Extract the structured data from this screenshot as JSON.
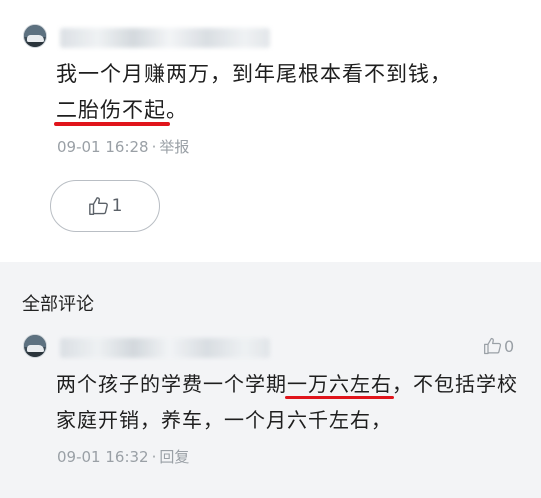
{
  "post": {
    "text_before": "我一个月赚两万，到年尾根本看不到钱，",
    "text_highlight": "二胎伤不起",
    "text_after": "。",
    "timestamp": "09-01 16:28",
    "separator": "·",
    "report_label": "举报",
    "like_count": "1"
  },
  "comments_section": {
    "title": "全部评论",
    "comments": [
      {
        "text_before": "两个孩子的学费一个学期",
        "text_highlight": "一万六左右",
        "text_after": "，不包括学校家庭开销，养车，一个月六千左右，",
        "timestamp": "09-01 16:32",
        "separator": "·",
        "reply_label": "回复",
        "like_count": "0"
      }
    ]
  },
  "colors": {
    "highlight_underline": "#e0141b",
    "meta_text": "#9aa0a6",
    "comments_background": "#f3f4f6"
  },
  "icons": {
    "like": "thumbs-up-icon",
    "avatar": "car-photo-avatar"
  }
}
